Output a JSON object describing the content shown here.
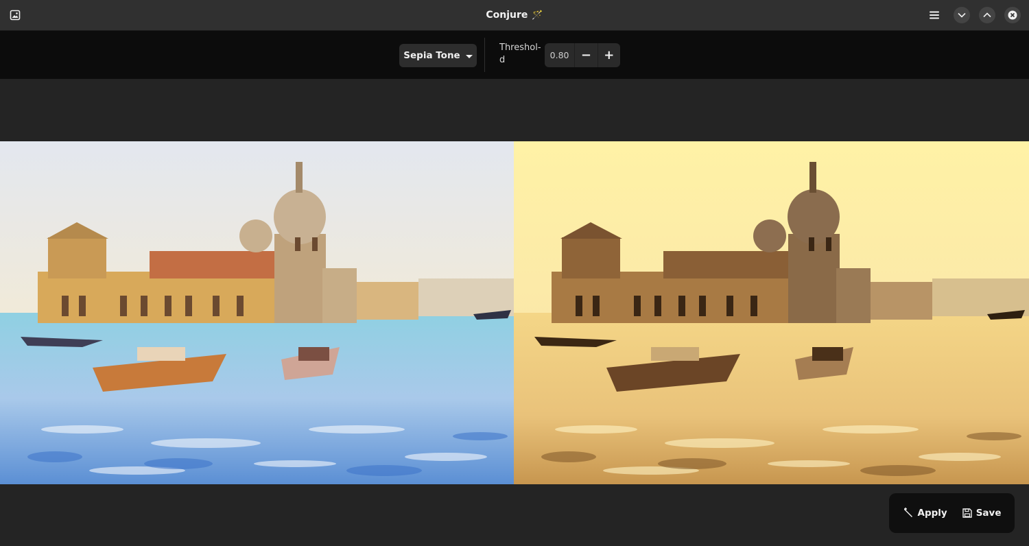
{
  "window": {
    "title": "Conjure",
    "title_emoji": "🪄"
  },
  "header": {
    "icons": [
      "image-icon",
      "hamburger-menu-icon",
      "chevron-down-icon",
      "chevron-up-icon",
      "close-icon"
    ]
  },
  "toolbar": {
    "filter_selected": "Sepia Tone",
    "threshold_label": "Threshol-\nd",
    "threshold_value": "0.80",
    "decrement_label": "−",
    "increment_label": "+"
  },
  "actions": {
    "apply_label": "Apply",
    "save_label": "Save",
    "apply_icon": "magic-wand-icon",
    "save_icon": "floppy-disk-icon"
  },
  "colors": {
    "window_bg": "#242424",
    "header_bg": "#303030",
    "toolbar_bg": "#0c0c0c",
    "sepia_tint": "#f5d98a"
  }
}
